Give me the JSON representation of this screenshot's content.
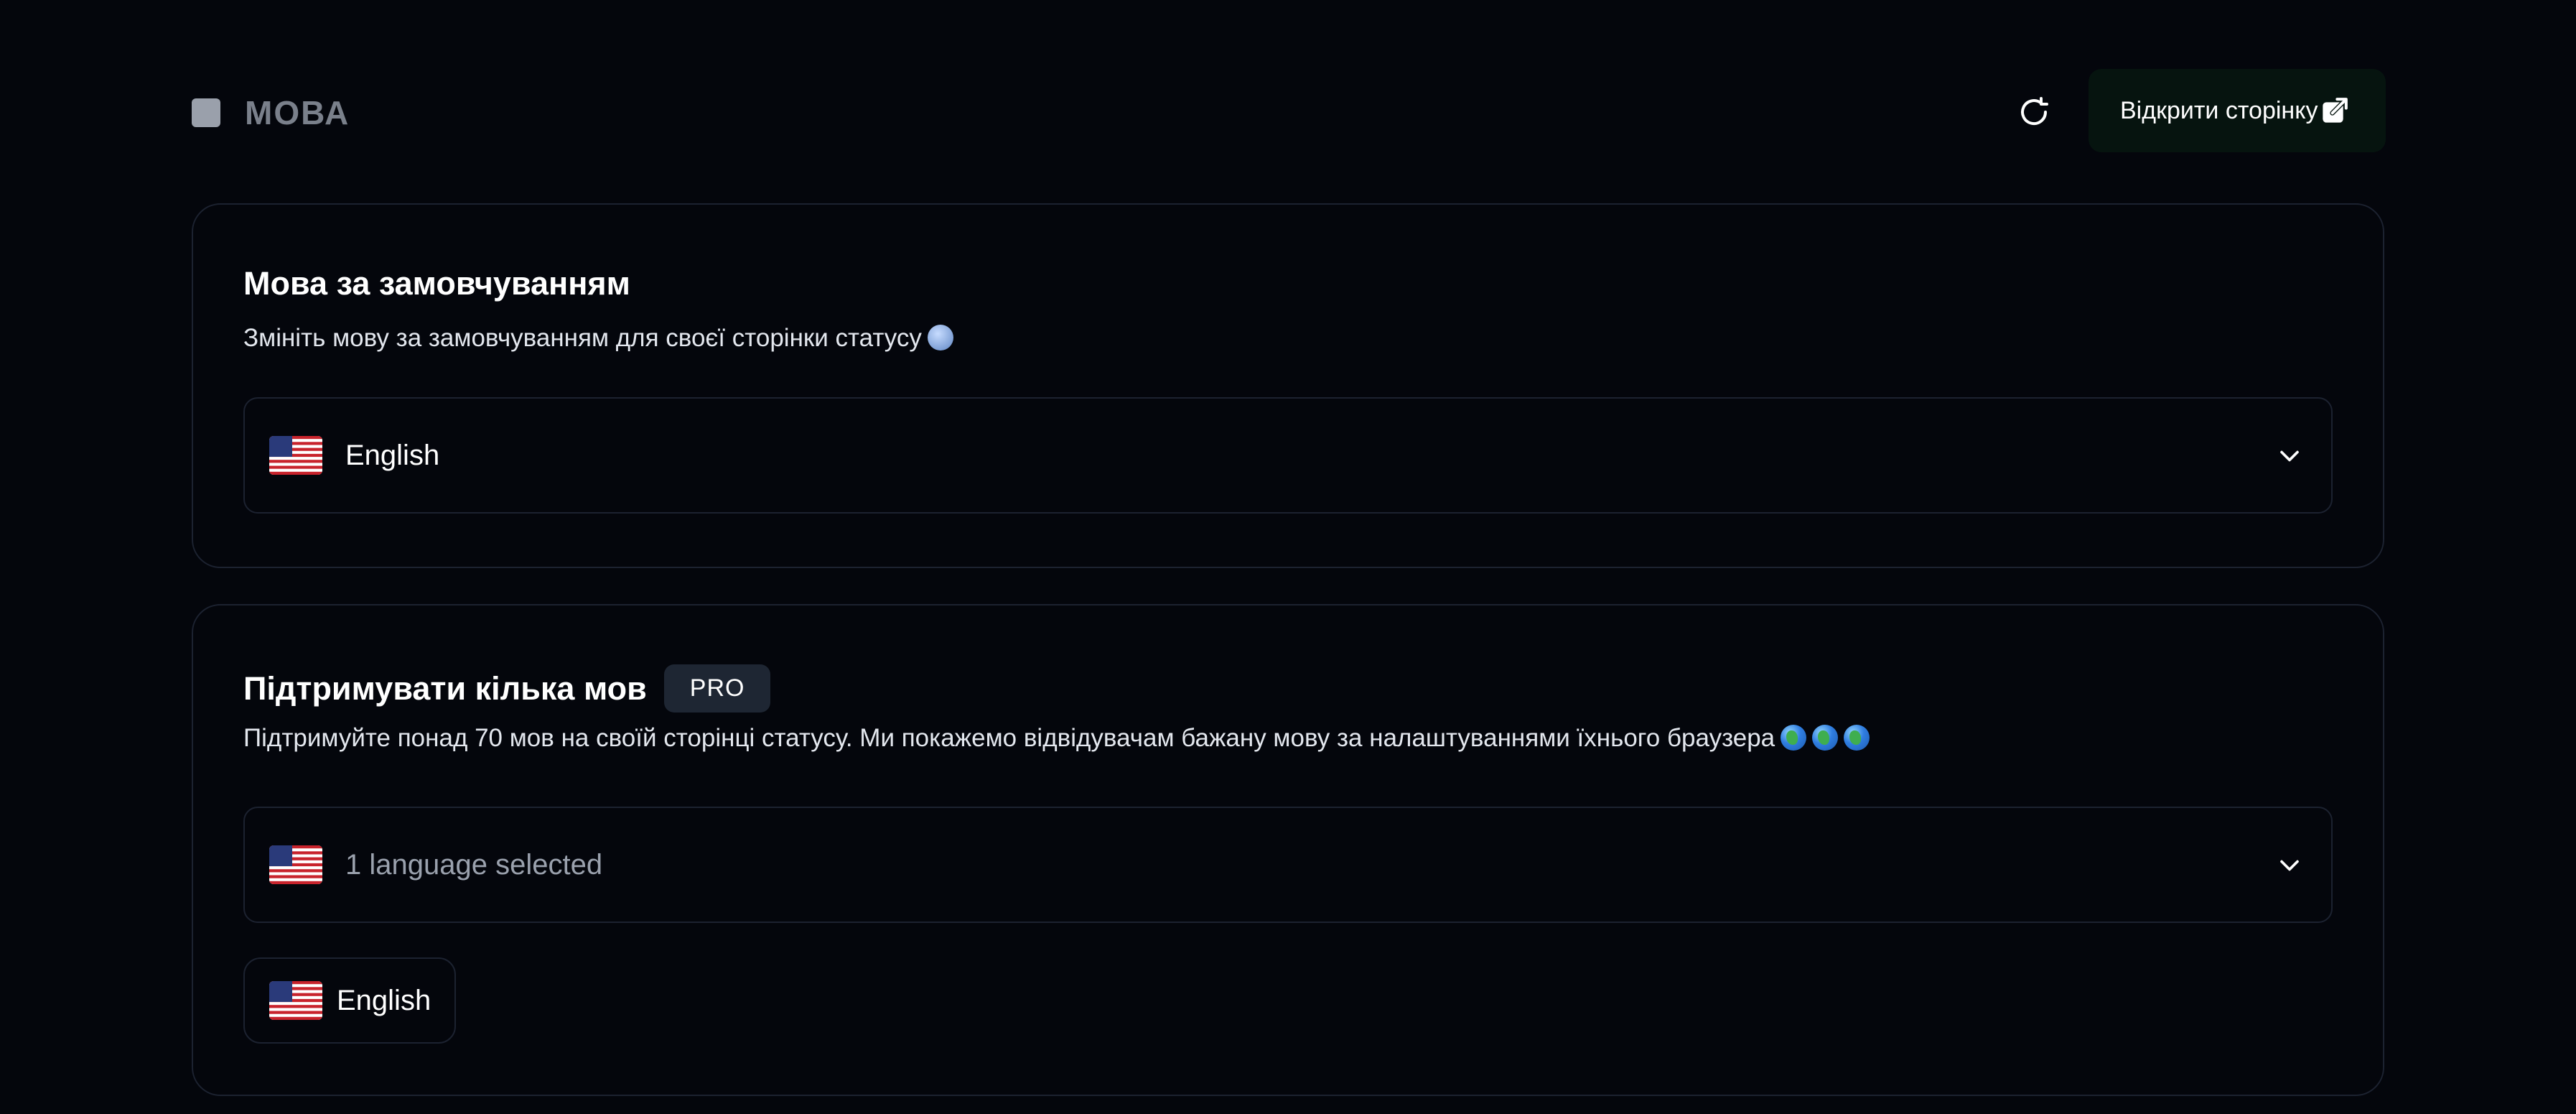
{
  "header": {
    "section_title": "МОВА",
    "open_page_label": "Відкрити сторінку",
    "icons": {
      "section": "square-icon",
      "refresh": "refresh-icon",
      "external": "external-link-icon"
    }
  },
  "default_language": {
    "title": "Мова за замовчуванням",
    "description": "Змініть мову за замовчуванням для своєї сторінки статусу",
    "selected": "English",
    "flag": "us-flag-icon"
  },
  "multi_language": {
    "title": "Підтримувати кілька мов",
    "badge": "PRO",
    "description": "Підтримуйте понад 70 мов на своїй сторінці статусу. Ми покажемо відвідувачам бажану мову за налаштуваннями їхнього браузера",
    "select_summary": "1 language selected",
    "chips": [
      {
        "label": "English",
        "flag": "us-flag-icon"
      }
    ]
  },
  "colors": {
    "background": "#04060c",
    "border": "#1c2230",
    "open_button_bg": "#06140f",
    "badge_bg": "#1e2633",
    "muted_text": "#9aa1ad"
  }
}
